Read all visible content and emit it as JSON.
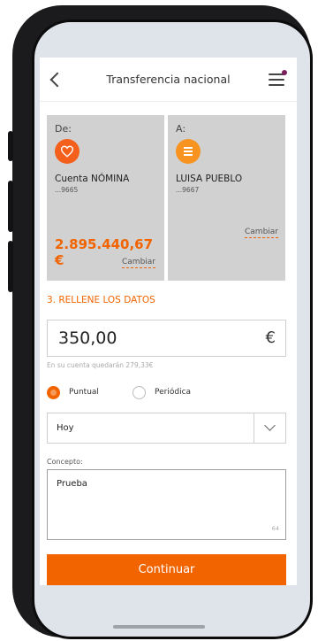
{
  "header": {
    "title": "Transferencia nacional"
  },
  "from_card": {
    "label": "De:",
    "icon": "heart-icon",
    "account_name": "Cuenta NÓMINA",
    "account_number": "...9665",
    "balance": "2.895.440,67 €",
    "change_label": "Cambiar"
  },
  "to_card": {
    "label": "A:",
    "icon": "list-icon",
    "account_name": "LUISA PUEBLO",
    "account_number": "...9667",
    "change_label": "Cambiar"
  },
  "form": {
    "section_title": "3. RELLENE LOS DATOS",
    "amount": "350,00",
    "currency": "€",
    "balance_hint": "En su cuenta quedarán 279,33€",
    "frequency_options": [
      {
        "label": "Puntual",
        "selected": true
      },
      {
        "label": "Periódica",
        "selected": false
      }
    ],
    "date_selected": "Hoy",
    "concept_label": "Concepto:",
    "concept_value": "Prueba",
    "concept_remaining": "64",
    "continue_label": "Continuar"
  },
  "colors": {
    "accent": "#f26400",
    "card_background": "#d1d1d1",
    "heart_icon": "#f4601b",
    "list_icon": "#f7931e"
  }
}
